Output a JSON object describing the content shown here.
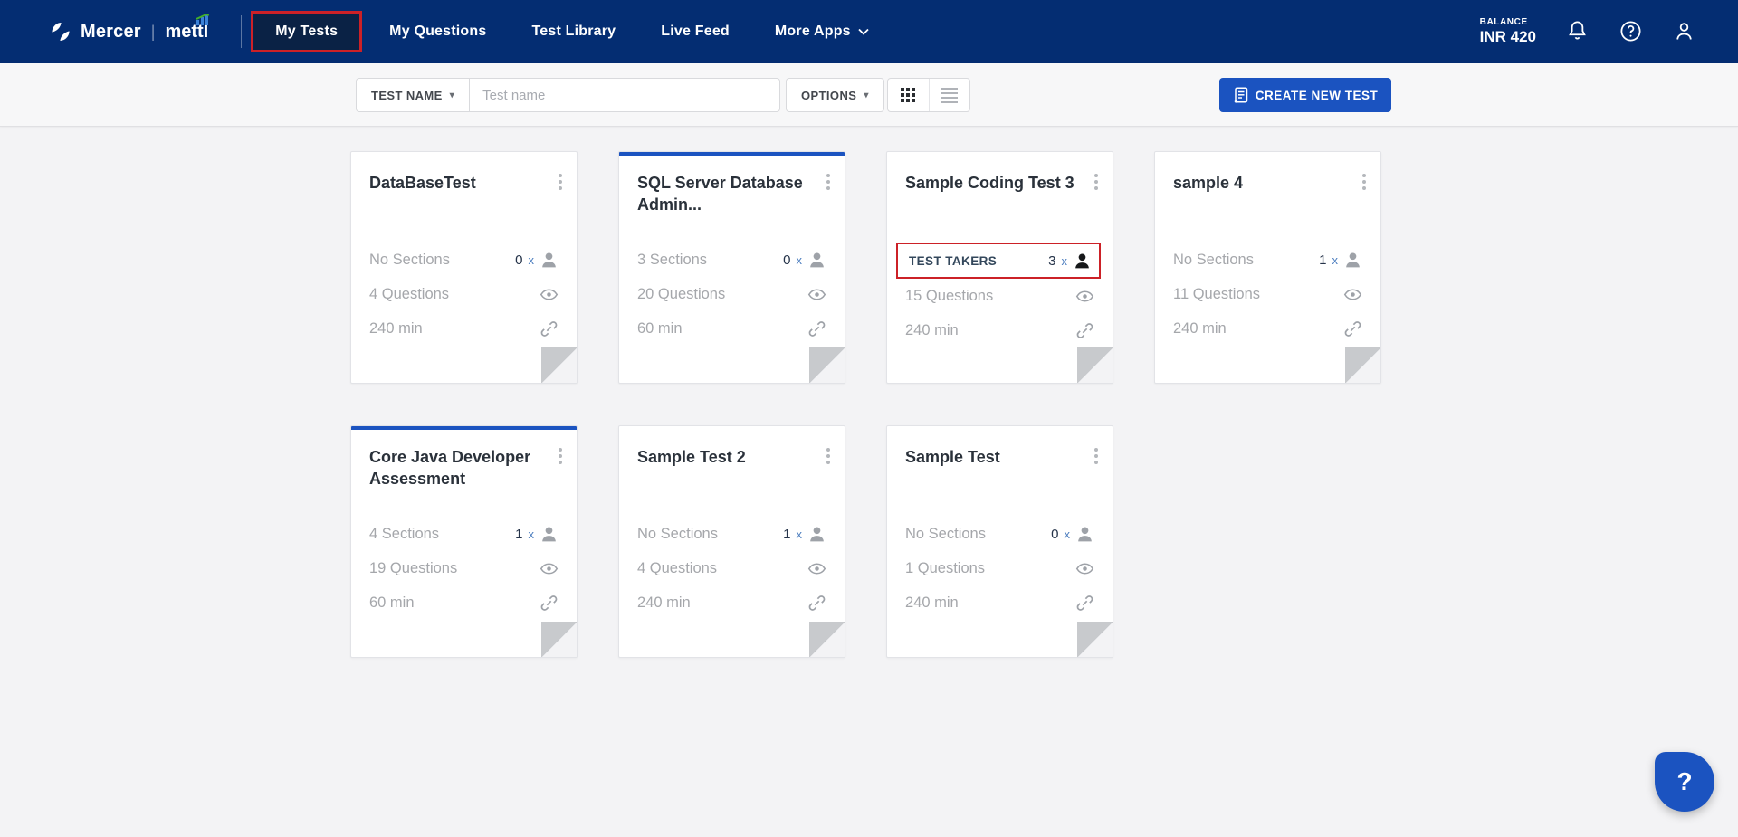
{
  "navbar": {
    "brand": {
      "mercer": "Mercer",
      "separator": "|",
      "mettl": "mettl"
    },
    "items": [
      {
        "label": "My Tests",
        "selected": true
      },
      {
        "label": "My Questions",
        "selected": false
      },
      {
        "label": "Test Library",
        "selected": false
      },
      {
        "label": "Live Feed",
        "selected": false
      },
      {
        "label": "More Apps",
        "selected": false
      }
    ],
    "balance": {
      "label": "BALANCE",
      "value": "INR 420"
    }
  },
  "toolbar": {
    "filter_label": "TEST NAME",
    "search_placeholder": "Test name",
    "options_label": "OPTIONS",
    "create_button_label": "CREATE NEW TEST"
  },
  "times_symbol": "x",
  "cards": [
    {
      "title": "DataBaseTest",
      "accent_top": false,
      "highlighted_takers": false,
      "sections_label": "No Sections",
      "takers_count": "0",
      "questions_label": "4 Questions",
      "duration_label": "240 min"
    },
    {
      "title": "SQL Server Database Admin...",
      "accent_top": true,
      "highlighted_takers": false,
      "sections_label": "3 Sections",
      "takers_count": "0",
      "questions_label": "20 Questions",
      "duration_label": "60 min"
    },
    {
      "title": "Sample Coding Test 3",
      "accent_top": false,
      "highlighted_takers": true,
      "takers_box_label": "TEST TAKERS",
      "sections_label": "",
      "takers_count": "3",
      "questions_label": "15 Questions",
      "duration_label": "240 min"
    },
    {
      "title": "sample 4",
      "accent_top": false,
      "highlighted_takers": false,
      "sections_label": "No Sections",
      "takers_count": "1",
      "questions_label": "11 Questions",
      "duration_label": "240 min"
    },
    {
      "title": "Core Java Developer Assessment",
      "accent_top": true,
      "highlighted_takers": false,
      "sections_label": "4 Sections",
      "takers_count": "1",
      "questions_label": "19 Questions",
      "duration_label": "60 min"
    },
    {
      "title": "Sample Test 2",
      "accent_top": false,
      "highlighted_takers": false,
      "sections_label": "No Sections",
      "takers_count": "1",
      "questions_label": "4 Questions",
      "duration_label": "240 min"
    },
    {
      "title": "Sample Test",
      "accent_top": false,
      "highlighted_takers": false,
      "sections_label": "No Sections",
      "takers_count": "0",
      "questions_label": "1 Questions",
      "duration_label": "240 min"
    }
  ],
  "help_button_label": "?",
  "colors": {
    "navbar": "#042d72",
    "accent_blue": "#1b53c0",
    "highlight_red": "#cc2127"
  }
}
